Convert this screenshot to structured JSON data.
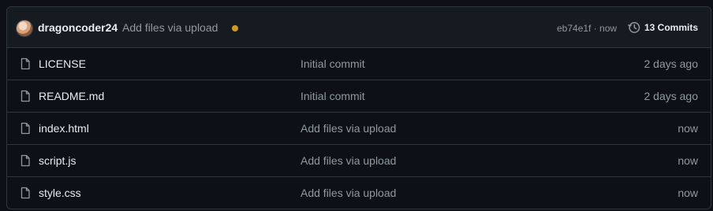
{
  "latest_commit": {
    "author": "dragoncoder24",
    "message": "Add files via upload",
    "sha_time": "eb74e1f · now",
    "commits_label": "13 Commits",
    "status_color": "#d29922"
  },
  "files": [
    {
      "name": "LICENSE",
      "commit_message": "Initial commit",
      "age": "2 days ago",
      "icon": "file-icon"
    },
    {
      "name": "README.md",
      "commit_message": "Initial commit",
      "age": "2 days ago",
      "icon": "file-icon"
    },
    {
      "name": "index.html",
      "commit_message": "Add files via upload",
      "age": "now",
      "icon": "file-icon"
    },
    {
      "name": "script.js",
      "commit_message": "Add files via upload",
      "age": "now",
      "icon": "file-icon"
    },
    {
      "name": "style.css",
      "commit_message": "Add files via upload",
      "age": "now",
      "icon": "file-icon"
    }
  ]
}
